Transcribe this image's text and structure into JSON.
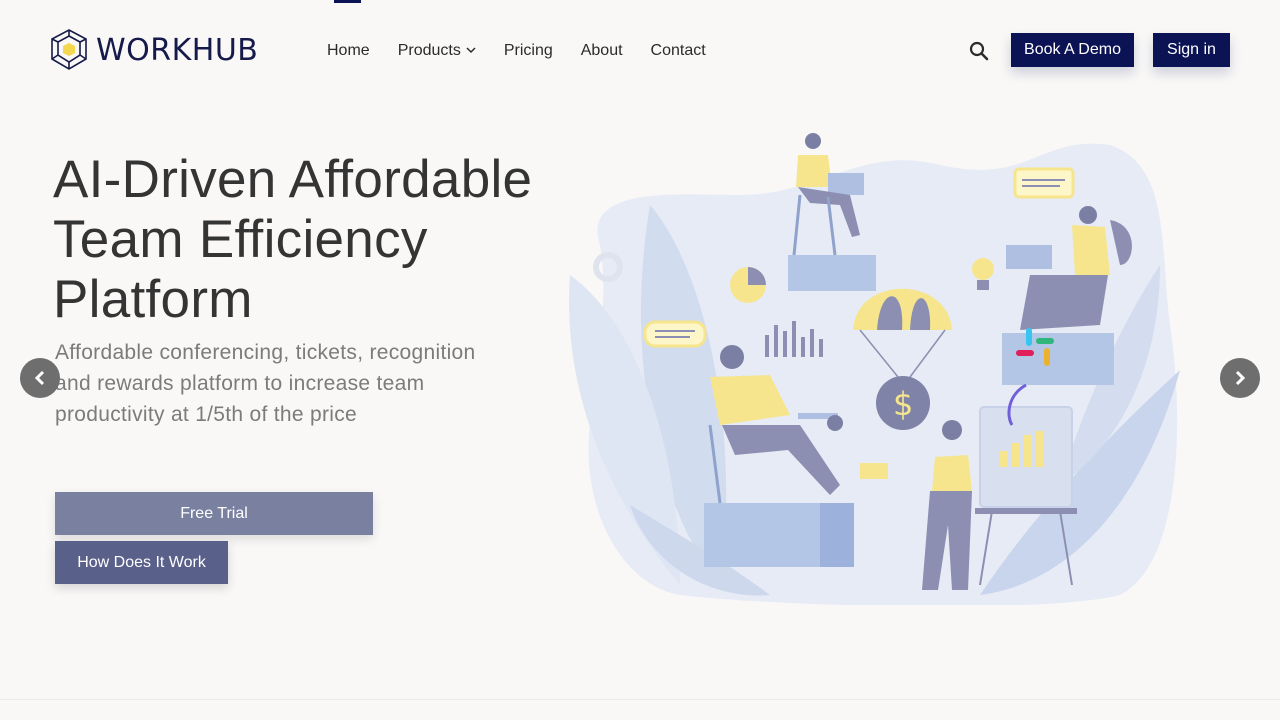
{
  "brand": {
    "name": "WORKHUB",
    "logo_icon": "hexagon-cube-logo"
  },
  "nav": {
    "items": [
      {
        "label": "Home"
      },
      {
        "label": "Products",
        "has_dropdown": true
      },
      {
        "label": "Pricing"
      },
      {
        "label": "About"
      },
      {
        "label": "Contact"
      }
    ]
  },
  "header_actions": {
    "search_icon": "search-icon",
    "demo_label": "Book A Demo",
    "signin_label": "Sign in"
  },
  "hero": {
    "title": "AI-Driven Affordable Team Efficiency Platform",
    "subtitle": "Affordable conferencing, tickets, recognition and rewards platform to increase team productivity at 1/5th of the price",
    "primary_cta": "Free Trial",
    "secondary_cta": "How Does It Work"
  },
  "carousel": {
    "prev_icon": "chevron-left-icon",
    "next_icon": "chevron-right-icon"
  },
  "colors": {
    "brand_dark": "#0b1354",
    "cta_primary": "#7a80a0",
    "cta_secondary": "#59608a",
    "illustration_blue": "#b9c8e6",
    "illustration_yellow": "#f6e58d"
  }
}
